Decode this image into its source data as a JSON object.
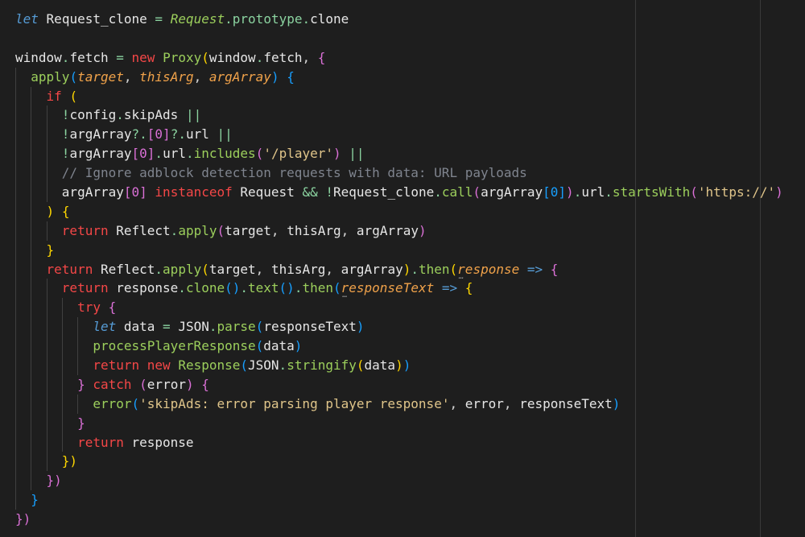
{
  "colors": {
    "background": "#1e1e1e",
    "default": "#d4d4d4",
    "keyword_blue": "#569cd6",
    "keyword_control": "#c586c0",
    "keyword_red": "#f44747",
    "variable": "#e6e6e6",
    "property": "#8bd3a0",
    "function": "#9ccf5c",
    "param": "#f0a24a",
    "string": "#e0c58a",
    "bracket_yellow": "#ffd700",
    "bracket_pink": "#da70d6",
    "bracket_blue": "#179fff",
    "operator": "#e05a5a",
    "comment": "#7f848e",
    "class_green": "#9ccf5c"
  },
  "code_lines": [
    [
      [
        "let",
        "kwi"
      ],
      [
        " ",
        "d"
      ],
      [
        "Request_clone",
        "v"
      ],
      [
        " ",
        "d"
      ],
      [
        "=",
        "op"
      ],
      [
        " ",
        "d"
      ],
      [
        "Request",
        "clsi"
      ],
      [
        ".",
        "op"
      ],
      [
        "prototype",
        "prop"
      ],
      [
        ".",
        "op"
      ],
      [
        "clone",
        "v"
      ]
    ],
    [],
    [
      [
        "window",
        "v"
      ],
      [
        ".",
        "op"
      ],
      [
        "fetch",
        "v"
      ],
      [
        " ",
        "d"
      ],
      [
        "=",
        "op"
      ],
      [
        " ",
        "d"
      ],
      [
        "new",
        "kwr"
      ],
      [
        " ",
        "d"
      ],
      [
        "Proxy",
        "cls"
      ],
      [
        "(",
        "b1"
      ],
      [
        "window",
        "v"
      ],
      [
        ".",
        "op"
      ],
      [
        "fetch",
        "v"
      ],
      [
        ",",
        "d"
      ],
      [
        " ",
        "d"
      ],
      [
        "{",
        "b2"
      ]
    ],
    [
      [
        "apply",
        "fn"
      ],
      [
        "(",
        "b3"
      ],
      [
        "target",
        "pi"
      ],
      [
        ",",
        "d"
      ],
      [
        " ",
        "d"
      ],
      [
        "thisArg",
        "pi"
      ],
      [
        ",",
        "d"
      ],
      [
        " ",
        "d"
      ],
      [
        "argArray",
        "pi"
      ],
      [
        ")",
        "b3"
      ],
      [
        " ",
        "d"
      ],
      [
        "{",
        "b3"
      ]
    ],
    [
      [
        "if",
        "kwr"
      ],
      [
        " ",
        "d"
      ],
      [
        "(",
        "b1"
      ]
    ],
    [
      [
        "!",
        "op"
      ],
      [
        "config",
        "v"
      ],
      [
        ".",
        "op"
      ],
      [
        "skipAds",
        "v"
      ],
      [
        " ",
        "d"
      ],
      [
        "||",
        "op"
      ]
    ],
    [
      [
        "!",
        "op"
      ],
      [
        "argArray",
        "v"
      ],
      [
        "?.",
        "op"
      ],
      [
        "[",
        "b2"
      ],
      [
        "0",
        "b2"
      ],
      [
        "]",
        "b2"
      ],
      [
        "?.",
        "op"
      ],
      [
        "url",
        "v"
      ],
      [
        " ",
        "d"
      ],
      [
        "||",
        "op"
      ]
    ],
    [
      [
        "!",
        "op"
      ],
      [
        "argArray",
        "v"
      ],
      [
        "[",
        "b2"
      ],
      [
        "0",
        "b2"
      ],
      [
        "]",
        "b2"
      ],
      [
        ".",
        "op"
      ],
      [
        "url",
        "v"
      ],
      [
        ".",
        "op"
      ],
      [
        "includes",
        "fn"
      ],
      [
        "(",
        "b2"
      ],
      [
        "'/player'",
        "str"
      ],
      [
        ")",
        "b2"
      ],
      [
        " ",
        "d"
      ],
      [
        "||",
        "op"
      ]
    ],
    [
      [
        "// Ignore adblock detection requests with data: URL payloads",
        "cm"
      ]
    ],
    [
      [
        "argArray",
        "v"
      ],
      [
        "[",
        "b2"
      ],
      [
        "0",
        "b2"
      ],
      [
        "]",
        "b2"
      ],
      [
        " ",
        "d"
      ],
      [
        "instanceof",
        "kwr"
      ],
      [
        " ",
        "d"
      ],
      [
        "Request",
        "v"
      ],
      [
        " ",
        "d"
      ],
      [
        "&&",
        "op"
      ],
      [
        " ",
        "d"
      ],
      [
        "!",
        "op"
      ],
      [
        "Request_clone",
        "v"
      ],
      [
        ".",
        "op"
      ],
      [
        "call",
        "fn"
      ],
      [
        "(",
        "b2"
      ],
      [
        "argArray",
        "v"
      ],
      [
        "[",
        "b3"
      ],
      [
        "0",
        "b3"
      ],
      [
        "]",
        "b3"
      ],
      [
        ")",
        "b2"
      ],
      [
        ".",
        "op"
      ],
      [
        "url",
        "v"
      ],
      [
        ".",
        "op"
      ],
      [
        "startsWith",
        "fn"
      ],
      [
        "(",
        "b2"
      ],
      [
        "'https://'",
        "str"
      ],
      [
        ")",
        "b2"
      ]
    ],
    [
      [
        ")",
        "b1"
      ],
      [
        " ",
        "d"
      ],
      [
        "{",
        "b1"
      ]
    ],
    [
      [
        "return",
        "kwr"
      ],
      [
        " ",
        "d"
      ],
      [
        "Reflect",
        "v"
      ],
      [
        ".",
        "op"
      ],
      [
        "apply",
        "fn"
      ],
      [
        "(",
        "b2"
      ],
      [
        "target",
        "v"
      ],
      [
        ",",
        "d"
      ],
      [
        " ",
        "d"
      ],
      [
        "thisArg",
        "v"
      ],
      [
        ",",
        "d"
      ],
      [
        " ",
        "d"
      ],
      [
        "argArray",
        "v"
      ],
      [
        ")",
        "b2"
      ]
    ],
    [
      [
        "}",
        "b1"
      ]
    ],
    [
      [
        "return",
        "kwr"
      ],
      [
        " ",
        "d"
      ],
      [
        "Reflect",
        "v"
      ],
      [
        ".",
        "op"
      ],
      [
        "apply",
        "fn"
      ],
      [
        "(",
        "b1"
      ],
      [
        "target",
        "v"
      ],
      [
        ",",
        "d"
      ],
      [
        " ",
        "d"
      ],
      [
        "thisArg",
        "v"
      ],
      [
        ",",
        "d"
      ],
      [
        " ",
        "d"
      ],
      [
        "argArray",
        "v"
      ],
      [
        ")",
        "b1"
      ],
      [
        ".",
        "op"
      ],
      [
        "then",
        "fn"
      ],
      [
        "(",
        "b1"
      ],
      [
        "response",
        "pi-dots"
      ],
      [
        " ",
        "d"
      ],
      [
        "=>",
        "kwb"
      ],
      [
        " ",
        "d"
      ],
      [
        "{",
        "b2"
      ]
    ],
    [
      [
        "return",
        "kwr"
      ],
      [
        " ",
        "d"
      ],
      [
        "response",
        "v"
      ],
      [
        ".",
        "op"
      ],
      [
        "clone",
        "fn"
      ],
      [
        "()",
        "b3"
      ],
      [
        ".",
        "op"
      ],
      [
        "text",
        "fn"
      ],
      [
        "()",
        "b3"
      ],
      [
        ".",
        "op"
      ],
      [
        "then",
        "fn"
      ],
      [
        "(",
        "b3"
      ],
      [
        "responseText",
        "pi-dots"
      ],
      [
        " ",
        "d"
      ],
      [
        "=>",
        "kwb"
      ],
      [
        " ",
        "d"
      ],
      [
        "{",
        "b1"
      ]
    ],
    [
      [
        "try",
        "kwr"
      ],
      [
        " ",
        "d"
      ],
      [
        "{",
        "b2"
      ]
    ],
    [
      [
        "let",
        "kwi"
      ],
      [
        " ",
        "d"
      ],
      [
        "data",
        "v"
      ],
      [
        " ",
        "d"
      ],
      [
        "=",
        "op"
      ],
      [
        " ",
        "d"
      ],
      [
        "JSON",
        "v"
      ],
      [
        ".",
        "op"
      ],
      [
        "parse",
        "fn"
      ],
      [
        "(",
        "b3"
      ],
      [
        "responseText",
        "v"
      ],
      [
        ")",
        "b3"
      ]
    ],
    [
      [
        "processPlayerResponse",
        "fn"
      ],
      [
        "(",
        "b3"
      ],
      [
        "data",
        "v"
      ],
      [
        ")",
        "b3"
      ]
    ],
    [
      [
        "return",
        "kwr"
      ],
      [
        " ",
        "d"
      ],
      [
        "new",
        "kwr"
      ],
      [
        " ",
        "d"
      ],
      [
        "Response",
        "cls"
      ],
      [
        "(",
        "b3"
      ],
      [
        "JSON",
        "v"
      ],
      [
        ".",
        "op"
      ],
      [
        "stringify",
        "fn"
      ],
      [
        "(",
        "b1"
      ],
      [
        "data",
        "v"
      ],
      [
        ")",
        "b1"
      ],
      [
        ")",
        "b3"
      ]
    ],
    [
      [
        "}",
        "b2"
      ],
      [
        " ",
        "d"
      ],
      [
        "catch",
        "kwr"
      ],
      [
        " ",
        "d"
      ],
      [
        "(",
        "b2"
      ],
      [
        "error",
        "v"
      ],
      [
        ")",
        "b2"
      ],
      [
        " ",
        "d"
      ],
      [
        "{",
        "b2"
      ]
    ],
    [
      [
        "error",
        "fn"
      ],
      [
        "(",
        "b3"
      ],
      [
        "'skipAds: error parsing player response'",
        "str"
      ],
      [
        ",",
        "d"
      ],
      [
        " ",
        "d"
      ],
      [
        "error",
        "v"
      ],
      [
        ",",
        "d"
      ],
      [
        " ",
        "d"
      ],
      [
        "responseText",
        "v"
      ],
      [
        ")",
        "b3"
      ]
    ],
    [
      [
        "}",
        "b2"
      ]
    ],
    [
      [
        "return",
        "kwr"
      ],
      [
        " ",
        "d"
      ],
      [
        "response",
        "v"
      ]
    ],
    [
      [
        "})",
        "b1"
      ]
    ],
    [
      [
        "})",
        "b2"
      ]
    ],
    [
      [
        "}",
        "b3"
      ]
    ],
    [
      [
        "})",
        "b2"
      ]
    ]
  ]
}
